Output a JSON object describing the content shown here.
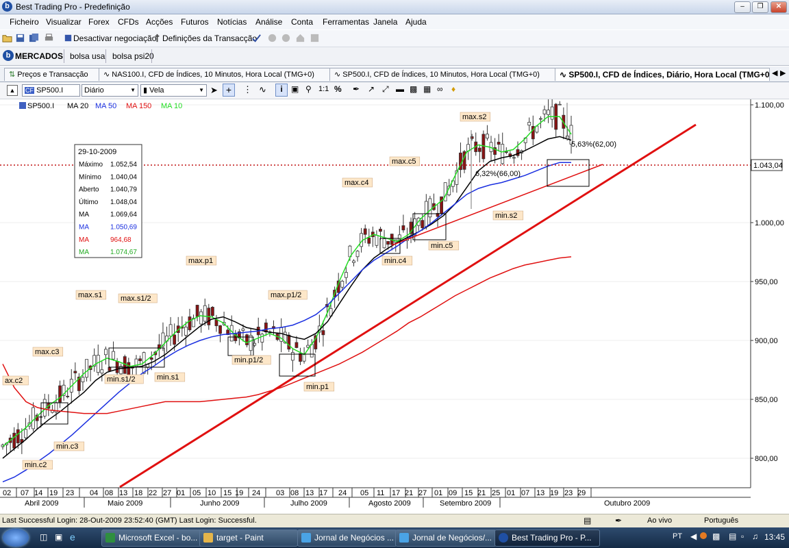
{
  "window": {
    "title": "Best Trading Pro - Predefinição"
  },
  "menu": [
    "Ficheiro",
    "Visualizar",
    "Forex",
    "CFDs",
    "Acções",
    "Futuros",
    "Notícias",
    "Análise",
    "Conta",
    "Ferramentas",
    "Janela",
    "Ajuda"
  ],
  "toolbar": {
    "deactivate_label": "Desactivar negociação",
    "settings_label": "Definições da Transacção"
  },
  "markets": {
    "title": "MERCADOS",
    "tabs": [
      "bolsa usa",
      "bolsa psi20"
    ]
  },
  "doc_tabs": [
    "Preços e Transacção",
    "NAS100.I, CFD de Índices, 10 Minutos, Hora Local (TMG+0)",
    "SP500.I, CFD de Índices, 10 Minutos, Hora Local (TMG+0)",
    "SP500.I, CFD de Índices, Diário, Hora Local (TMG+0)"
  ],
  "chart_toolbar": {
    "symbol": "SP500.I",
    "period": "Diário",
    "style": "Vela",
    "ratio_label": "1:1"
  },
  "legend": [
    {
      "label": "SP500.I",
      "color": "#000000"
    },
    {
      "label": "MA 20",
      "color": "#000000"
    },
    {
      "label": "MA 50",
      "color": "#1a2fe0"
    },
    {
      "label": "MA 150",
      "color": "#e01010"
    },
    {
      "label": "MA 10",
      "color": "#22dd22"
    }
  ],
  "infobox": {
    "date": "29-10-2009",
    "rows": [
      {
        "label": "Máximo",
        "value": "1.052,54",
        "color": "#000000"
      },
      {
        "label": "Mínimo",
        "value": "1.040,04",
        "color": "#000000"
      },
      {
        "label": "Aberto",
        "value": "1.040,79",
        "color": "#000000"
      },
      {
        "label": "Último",
        "value": "1.048,04",
        "color": "#000000"
      },
      {
        "label": "MA",
        "value": "1.069,64",
        "color": "#000000"
      },
      {
        "label": "MA",
        "value": "1.050,69",
        "color": "#1a2fe0"
      },
      {
        "label": "MA",
        "value": "964,68",
        "color": "#e01010"
      },
      {
        "label": "MA",
        "value": "1.074,67",
        "color": "#22aa22"
      }
    ]
  },
  "chart_data": {
    "type": "line",
    "y_ticks": [
      "1.100,00",
      "1.000,00",
      "950,00",
      "900,00",
      "850,00",
      "800,00"
    ],
    "y_tick_values": [
      1100,
      1000,
      950,
      900,
      850,
      800
    ],
    "y_range": [
      775,
      1105
    ],
    "current_price": "1.043,04",
    "current_value": 1043.04,
    "x_day_ticks": [
      "02",
      "07",
      "14",
      "19",
      "23",
      "04",
      "08",
      "13",
      "18",
      "22",
      "27",
      "01",
      "05",
      "10",
      "15",
      "19",
      "24",
      "03",
      "08",
      "13",
      "17",
      "24",
      "05",
      "11",
      "17",
      "21",
      "27",
      "01",
      "09",
      "15",
      "21",
      "25",
      "01",
      "07",
      "13",
      "19",
      "23",
      "29"
    ],
    "x_month_labels": [
      "Abril 2009",
      "Maio 2009",
      "Junho 2009",
      "Julho 2009",
      "Agosto 2009",
      "Setembro 2009",
      "Outubro 2009"
    ],
    "colors": {
      "ma20": "#000000",
      "ma50": "#1a2fe0",
      "ma150": "#e01010",
      "ma10": "#22dd22",
      "trend": "#e01010"
    },
    "series": [
      {
        "name": "MA 10",
        "values": [
          810,
          818,
          826,
          836,
          845,
          852,
          862,
          872,
          880,
          885,
          882,
          878,
          880,
          888,
          898,
          908,
          916,
          921,
          920,
          915,
          905,
          898,
          902,
          906,
          902,
          893,
          888,
          902,
          924,
          950,
          972,
          985,
          990,
          987,
          984,
          990,
          1003,
          1012,
          1020,
          1040,
          1060,
          1066,
          1064,
          1060,
          1062,
          1071,
          1082,
          1090,
          1090,
          1075
        ]
      },
      {
        "name": "MA 20",
        "values": [
          800,
          808,
          816,
          825,
          833,
          840,
          848,
          856,
          866,
          873,
          876,
          877,
          878,
          882,
          888,
          896,
          904,
          912,
          918,
          920,
          916,
          911,
          909,
          907,
          906,
          903,
          901,
          906,
          916,
          931,
          946,
          960,
          970,
          977,
          983,
          988,
          993,
          999,
          1006,
          1016,
          1030,
          1044,
          1052,
          1055,
          1057,
          1061,
          1066,
          1071,
          1073,
          1070
        ]
      },
      {
        "name": "MA 50",
        "values": [
          780,
          784,
          790,
          797,
          804,
          812,
          820,
          829,
          838,
          847,
          856,
          864,
          872,
          878,
          885,
          891,
          896,
          900,
          903,
          905,
          906,
          907,
          908,
          910,
          911,
          913,
          917,
          922,
          930,
          940,
          950,
          960,
          968,
          974,
          980,
          987,
          993,
          1000,
          1008,
          1016,
          1024,
          1029,
          1032,
          1034,
          1037,
          1040,
          1044,
          1048,
          1051,
          1051
        ]
      },
      {
        "name": "MA 150",
        "values": [
          880,
          860,
          848,
          843,
          841,
          840,
          839,
          838,
          838,
          838,
          840,
          842,
          844,
          846,
          848,
          848,
          848,
          848,
          849,
          850,
          851,
          852,
          854,
          857,
          860,
          864,
          868,
          872,
          876,
          880,
          885,
          890,
          896,
          902,
          908,
          915,
          920,
          926,
          932,
          938,
          943,
          948,
          953,
          957,
          961,
          964,
          966,
          968,
          970,
          971
        ]
      }
    ],
    "annotations": {
      "max_labels": [
        "ax.c2",
        "max.c3",
        "max.s1",
        "max.s1/2",
        "max.p1",
        "max.p1/2",
        "max.c4",
        "max.c5",
        "max.s2"
      ],
      "min_labels": [
        "min.c2",
        "min.c3",
        "min.s1/2",
        "min.s1",
        "min.p1/2",
        "min.p1",
        "min.c4",
        "min.c5",
        "min.s2"
      ],
      "pct_a": "5,63%(62,00)",
      "pct_b": "6,32%(66,00)"
    }
  },
  "status": {
    "login": "Last Successful Login: 28-Out-2009 23:52:40 (GMT)  Last Login: Successful.",
    "live": "Ao vivo",
    "language": "Português"
  },
  "taskbar": {
    "items": [
      "Microsoft Excel - bo...",
      "target - Paint",
      "Jornal de Negócios ...",
      "Jornal de Negócios/...",
      "Best Trading Pro - P..."
    ],
    "lang": "PT",
    "clock": "13:45"
  }
}
